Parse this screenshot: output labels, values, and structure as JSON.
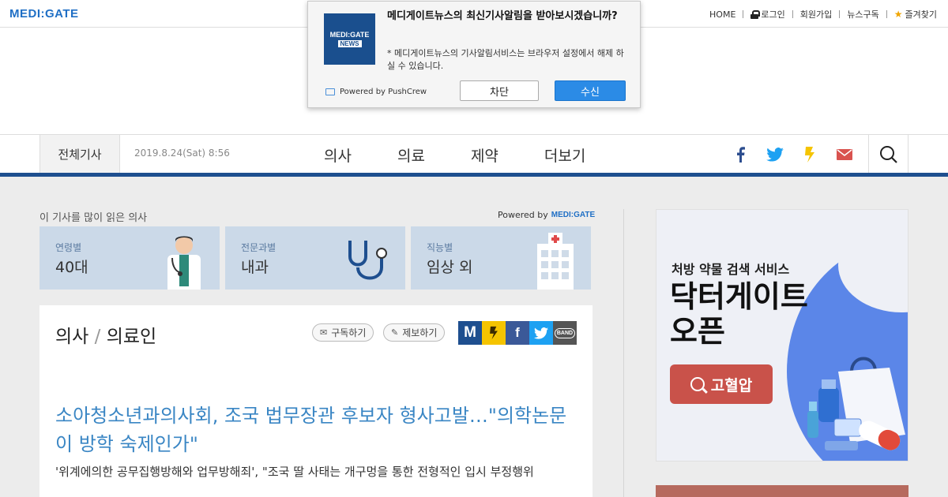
{
  "topbar": {
    "logo": "MEDI:GATE",
    "links": {
      "home": "HOME",
      "login": "로그인",
      "signup": "회원가입",
      "newsletter": "뉴스구독",
      "favorite": "즐겨찾기"
    }
  },
  "popup": {
    "logo_line1": "MEDI:GATE",
    "logo_line2": "NEWS",
    "title": "메디게이트뉴스의 최신기사알림을 받아보시겠습니까?",
    "description": "* 메디게이트뉴스의 기사알림서비스는 브라우저 설정에서 해제 하실 수 있습니다.",
    "powered": "Powered by PushCrew",
    "block_label": "차단",
    "accept_label": "수신"
  },
  "nav": {
    "all_articles": "전체기사",
    "date": "2019.8.24(Sat) 8:56",
    "menu": [
      "의사",
      "의료",
      "제약",
      "더보기"
    ]
  },
  "readers": {
    "heading": "이 기사를 많이 읽은 의사",
    "powered_prefix": "Powered by",
    "powered_brand": "MEDI:GATE",
    "stats": [
      {
        "label": "연령별",
        "value": "40대"
      },
      {
        "label": "전문과별",
        "value": "내과"
      },
      {
        "label": "직능별",
        "value": "임상 외"
      }
    ]
  },
  "article": {
    "section": "의사",
    "section_sep": "/",
    "section_sub": "의료인",
    "subscribe_label": "구독하기",
    "report_label": "제보하기",
    "share": [
      "M",
      "f",
      "BAND"
    ],
    "headline": "소아청소년과의사회, 조국 법무장관 후보자 형사고발…\"의학논문이 방학 숙제인가\"",
    "subhead": "'위계에의한 공무집행방해와 업무방해죄', \"조국 딸 사태는 개구멍을 통한 전형적인 입시 부정행위"
  },
  "ad": {
    "subtitle": "처방 약물 검색 서비스",
    "title_line1": "닥터게이트",
    "title_line2": "오픈",
    "button": "고혈압"
  },
  "colors": {
    "brand_blue": "#1f6fc5",
    "nav_line": "#1e4f8f",
    "headline_blue": "#3a86c4",
    "ad_button": "#c9524a",
    "stat_bg": "#cbd9e8"
  }
}
